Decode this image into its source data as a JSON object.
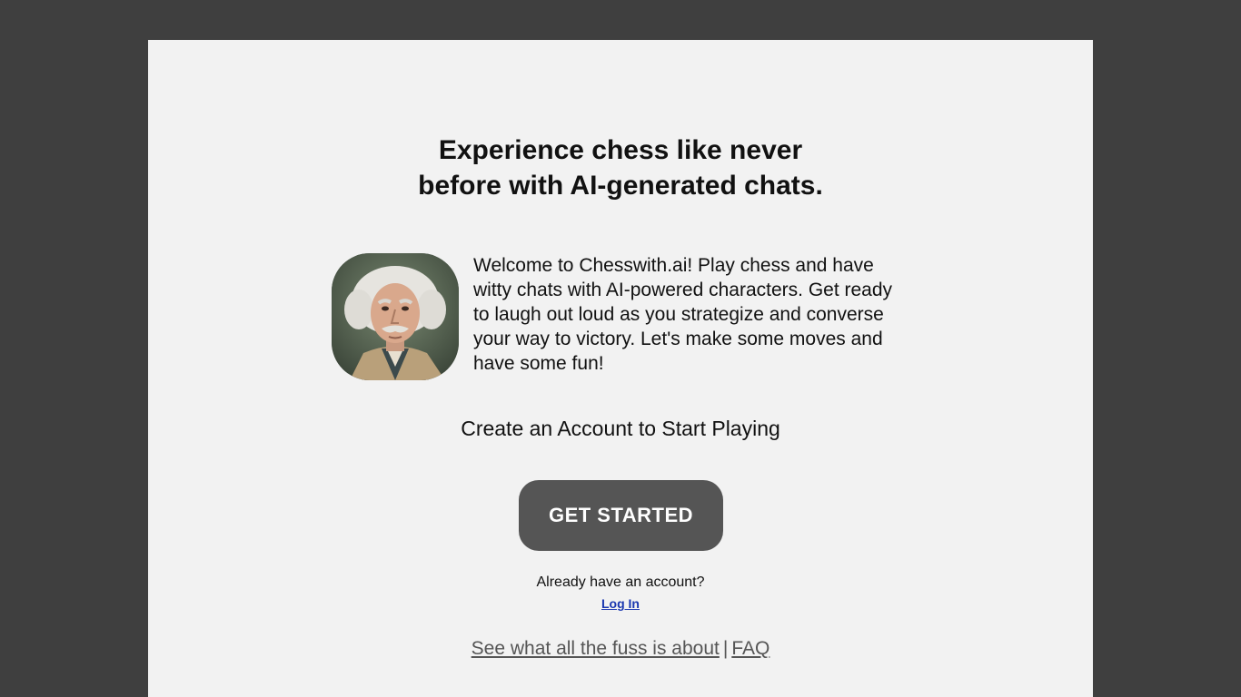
{
  "headline": {
    "line1": "Experience chess like never",
    "line2": "before with AI-generated chats."
  },
  "intro": {
    "avatar_icon": "einstein-portrait-avatar",
    "text": "Welcome to Chesswith.ai! Play chess and have witty chats with AI-powered characters. Get ready to laugh out loud as you strategize and converse your way to victory. Let's make some moves and have some fun!"
  },
  "cta": {
    "text": "Create an Account to Start Playing",
    "button_label": "GET STARTED"
  },
  "login": {
    "prompt": "Already have an account?",
    "link_label": "Log In"
  },
  "footer": {
    "fuss_link": "See what all the fuss is about",
    "separator": "|",
    "faq_link": "FAQ"
  },
  "colors": {
    "page_background": "#3f3f3f",
    "card_background": "#f2f2f2",
    "button_background": "#555555",
    "login_link": "#1a37b0"
  }
}
